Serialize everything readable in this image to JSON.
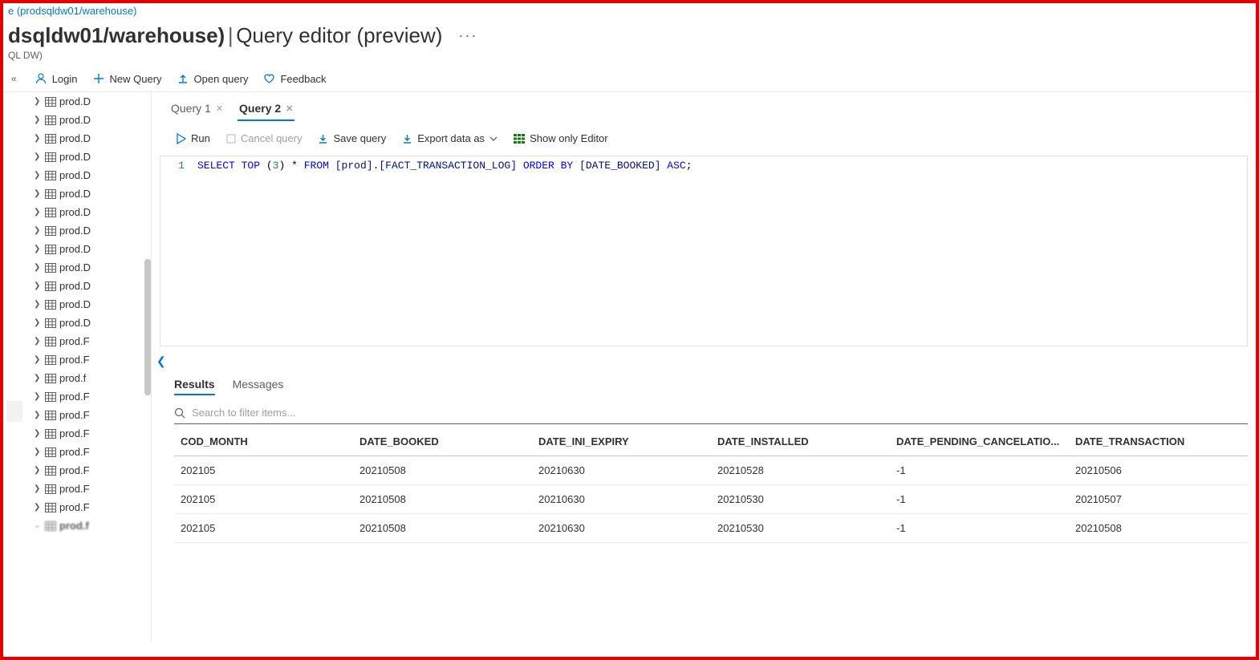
{
  "breadcrumb": "e (prodsqldw01/warehouse)",
  "header": {
    "title_left": "dsqldw01/warehouse)",
    "separator": "|",
    "title_right": "Query editor (preview)",
    "ellipsis": "···"
  },
  "subheader": "QL DW)",
  "commandbar": {
    "login": "Login",
    "new_query": "New Query",
    "open_query": "Open query",
    "feedback": "Feedback"
  },
  "tree": {
    "items": [
      "prod.D",
      "prod.D",
      "prod.D",
      "prod.D",
      "prod.D",
      "prod.D",
      "prod.D",
      "prod.D",
      "prod.D",
      "prod.D",
      "prod.D",
      "prod.D",
      "prod.D",
      "prod.F",
      "prod.F",
      "prod.f",
      "prod.F",
      "prod.F",
      "prod.F",
      "prod.F",
      "prod.F",
      "prod.F",
      "prod.F"
    ],
    "last": "prod.f"
  },
  "tabs": [
    {
      "label": "Query 1",
      "active": false
    },
    {
      "label": "Query 2",
      "active": true
    }
  ],
  "query_toolbar": {
    "run": "Run",
    "cancel": "Cancel query",
    "save": "Save query",
    "export": "Export data as",
    "show_editor": "Show only Editor"
  },
  "sql": {
    "line_no": "1",
    "tokens": {
      "select": "SELECT",
      "top": "TOP",
      "open_paren": "(",
      "n": "3",
      "close_paren": ")",
      "star": "*",
      "from": "FROM",
      "schema": "[prod]",
      "dot": ".",
      "table": "[FACT_TRANSACTION_LOG]",
      "order_by": "ORDER BY",
      "col": "[DATE_BOOKED]",
      "dir": "ASC",
      "semi": ";"
    }
  },
  "results_tabs": {
    "results": "Results",
    "messages": "Messages"
  },
  "search_placeholder": "Search to filter items...",
  "results": {
    "columns": [
      "COD_MONTH",
      "DATE_BOOKED",
      "DATE_INI_EXPIRY",
      "DATE_INSTALLED",
      "DATE_PENDING_CANCELATIO...",
      "DATE_TRANSACTION"
    ],
    "rows": [
      [
        "202105",
        "20210508",
        "20210630",
        "20210528",
        "-1",
        "20210506"
      ],
      [
        "202105",
        "20210508",
        "20210630",
        "20210530",
        "-1",
        "20210507"
      ],
      [
        "202105",
        "20210508",
        "20210630",
        "20210530",
        "-1",
        "20210508"
      ]
    ]
  }
}
